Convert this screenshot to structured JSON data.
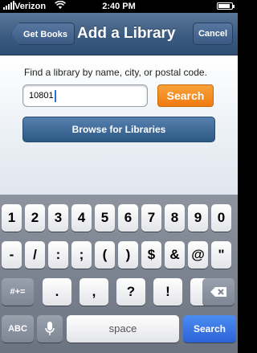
{
  "status_bar": {
    "carrier": "Verizon",
    "wifi_icon": "wifi-icon",
    "time": "2:40 PM",
    "battery_icon": "battery-icon"
  },
  "nav": {
    "back_label": "Get Books",
    "title": "Add a Library",
    "cancel_label": "Cancel"
  },
  "content": {
    "prompt": "Find a library by name, city, or postal code.",
    "search_value": "10801",
    "search_button": "Search",
    "browse_button": "Browse for Libraries"
  },
  "keyboard": {
    "row1": [
      "1",
      "2",
      "3",
      "4",
      "5",
      "6",
      "7",
      "8",
      "9",
      "0"
    ],
    "row2": [
      "-",
      "/",
      ":",
      ";",
      "(",
      ")",
      "$",
      "&",
      "@",
      "\""
    ],
    "row3_left": "#+=",
    "row3": [
      ".",
      ",",
      "?",
      "!",
      "'"
    ],
    "delete_icon": "backspace-icon",
    "abc": "ABC",
    "mic_icon": "microphone-icon",
    "space": "space",
    "search": "Search"
  },
  "colors": {
    "nav_bar": "#3c5b80",
    "search_button": "#f08a1e",
    "browse_button": "#3a6593",
    "keyboard_search_key": "#2c63d6"
  }
}
